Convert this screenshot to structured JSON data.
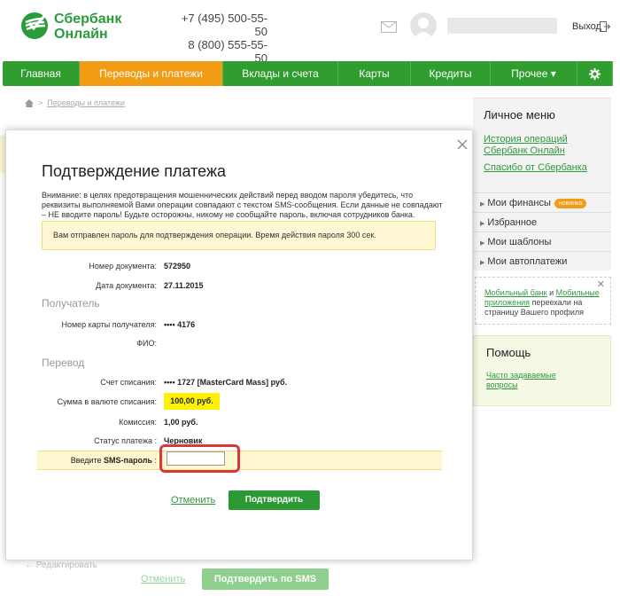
{
  "header": {
    "logo_line1": "Сбербанк",
    "logo_line2": "Онлайн",
    "phone1": "+7 (495) 500-55-50",
    "phone2": "8 (800) 555-55-50",
    "logout": "Выход",
    "brand_color": "#2a9c3c"
  },
  "nav": {
    "items": [
      {
        "label": "Главная"
      },
      {
        "label": "Переводы и платежи"
      },
      {
        "label": "Вклады и счета"
      },
      {
        "label": "Карты"
      },
      {
        "label": "Кредиты"
      },
      {
        "label": "Прочее ▾"
      }
    ],
    "active_index": 1,
    "active_color": "#f29b14",
    "bar_color": "#2f9e2f"
  },
  "breadcrumb": {
    "current": "Переводы и платежи"
  },
  "sidebar": {
    "title": "Личное меню",
    "links": [
      "История операций Сбербанк Онлайн",
      "Спасибо от Сбербанка"
    ],
    "items": [
      {
        "label": "Мои финансы",
        "badge": "новинка"
      },
      {
        "label": "Избранное"
      },
      {
        "label": "Мои шаблоны"
      },
      {
        "label": "Мои автоплатежи"
      }
    ],
    "notice": {
      "link1": "Мобильный банк",
      "and": " и ",
      "link2": "Мобильные приложения",
      "rest": " переехали на страницу Вашего профиля"
    },
    "help_title": "Помощь",
    "help_link": "Часто задаваемые вопросы"
  },
  "modal": {
    "title": "Подтверждение платежа",
    "warning": "Внимание: в целях предотвращения мошеннических действий перед вводом пароля убедитесь, что реквизиты выполняемой Вами операции совпадают с текстом SMS-сообщения. Если данные не совпадают – НЕ вводите пароль! Будьте осторожны, никому не сообщайте пароль, включая сотрудников банка.",
    "sms_notice": "Вам отправлен пароль для подтверждения операции. Время действия пароля 300 сек.",
    "doc_number_label": "Номер документа:",
    "doc_number": "572950",
    "doc_date_label": "Дата документа:",
    "doc_date": "27.11.2015",
    "section_recipient": "Получатель",
    "card_label": "Номер карты получателя:",
    "card_value": "•••• 4176",
    "fio_label": "ФИО:",
    "section_transfer": "Перевод",
    "account_label": "Счет списания:",
    "account_value": "•••• 1727  [MasterCard Mass]  руб.",
    "amount_label": "Сумма в валюте списания:",
    "amount_value": "100,00  руб.",
    "fee_label": "Комиссия:",
    "fee_value": "1,00 руб.",
    "status_label": "Статус платежа :",
    "status_value": "Черновик",
    "sms_label_prefix": "Введите ",
    "sms_label_bold": "SMS-пароль",
    "sms_label_suffix": " :",
    "sms_value": "",
    "cancel": "Отменить",
    "confirm": "Подтвердить"
  },
  "background": {
    "edit": "Редактировать",
    "cancel": "Отменить",
    "confirm_sms": "Подтвердить по SMS"
  }
}
